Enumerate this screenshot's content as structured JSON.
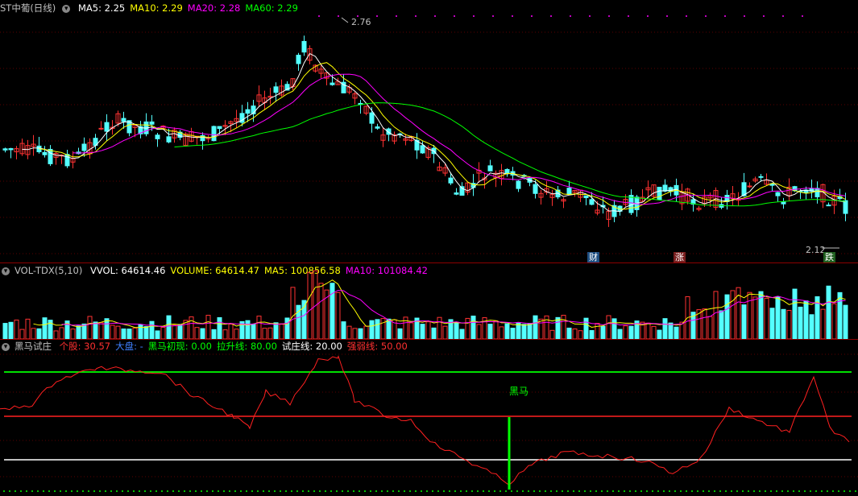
{
  "price_panel": {
    "title": "ST中葡(日线)",
    "ma": [
      {
        "label": "MA5: 2.25",
        "color": "#ffffff"
      },
      {
        "label": "MA10: 2.29",
        "color": "#ffff00"
      },
      {
        "label": "MA20: 2.28",
        "color": "#ff00ff"
      },
      {
        "label": "MA60: 2.29",
        "color": "#00ff00"
      }
    ],
    "high_label": "2.76",
    "low_label": "2.12",
    "markers": [
      {
        "text": "财",
        "color": "#2a6fb0"
      },
      {
        "text": "涨",
        "color": "#b02a2a"
      },
      {
        "text": "跌",
        "color": "#2a8a2a"
      }
    ]
  },
  "volume_panel": {
    "title": "VOL-TDX(5,10)",
    "items": [
      {
        "label": "VVOL: 64614.46",
        "color": "#ffffff"
      },
      {
        "label": "VOLUME: 64614.47",
        "color": "#ffff00"
      },
      {
        "label": "MA5: 100856.58",
        "color": "#ffff00"
      },
      {
        "label": "MA10: 101084.42",
        "color": "#ff00ff"
      }
    ]
  },
  "indicator_panel": {
    "title": "黑马试庄",
    "items": [
      {
        "label": "个股: 30.57",
        "color": "#ff3030"
      },
      {
        "label": "大盘: -",
        "color": "#4080ff"
      },
      {
        "label": "黑马初现: 0.00",
        "color": "#00ff00"
      },
      {
        "label": "拉升线: 80.00",
        "color": "#00ff00"
      },
      {
        "label": "试庄线: 20.00",
        "color": "#ffffff"
      },
      {
        "label": "强弱线: 50.00",
        "color": "#ff3030"
      }
    ],
    "annotation": "黑马"
  },
  "colors": {
    "up": "#ff3232",
    "down": "#54ffff",
    "ma5": "#ffffff",
    "ma10": "#ffff00",
    "ma20": "#ff00ff",
    "ma60": "#00ff00"
  }
}
